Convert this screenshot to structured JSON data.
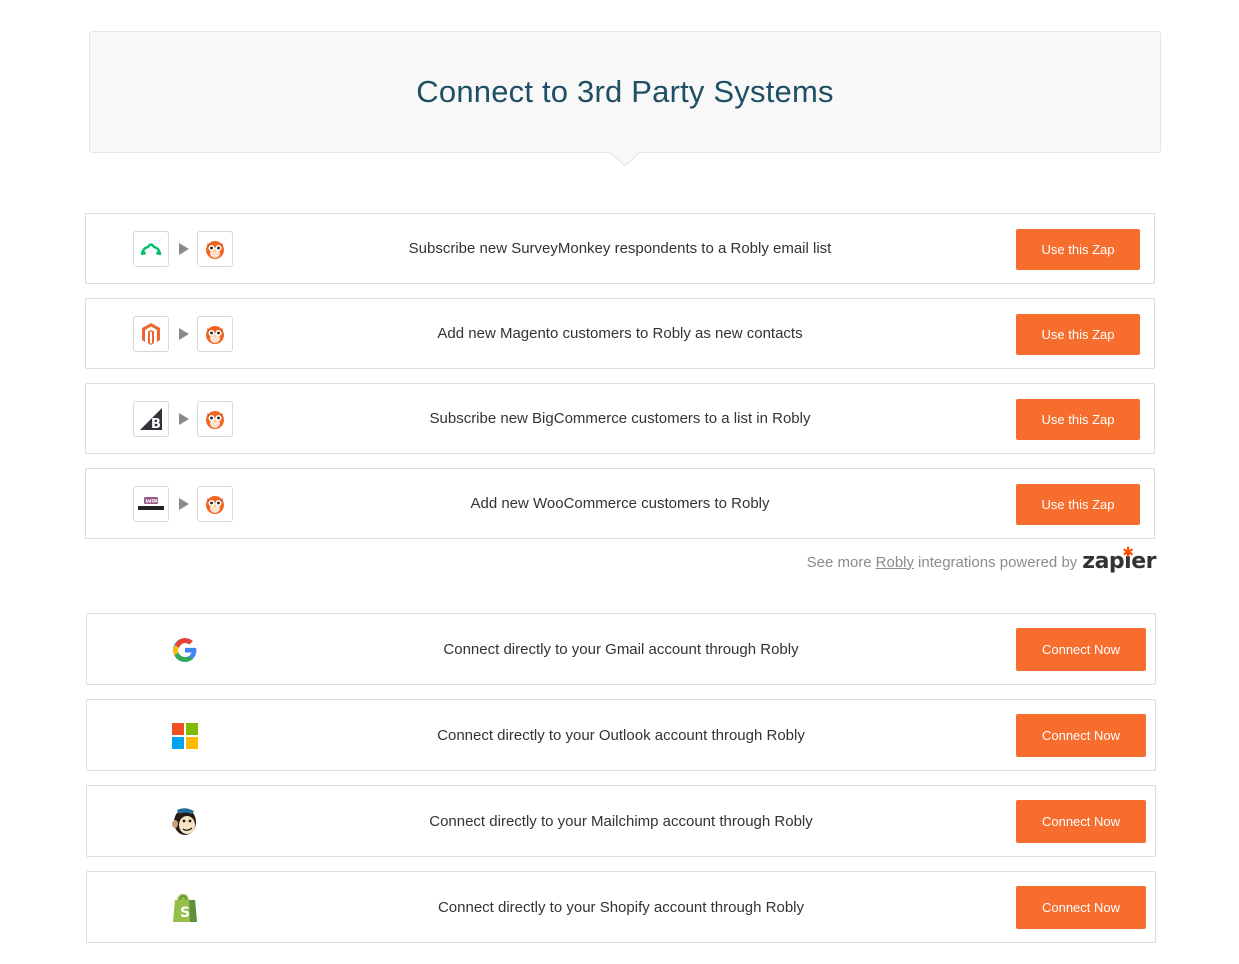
{
  "header": {
    "title": "Connect to 3rd Party Systems"
  },
  "zaps": [
    {
      "app_icon": "surveymonkey-icon",
      "text": "Subscribe new SurveyMonkey respondents to a Robly email list",
      "button": "Use this Zap"
    },
    {
      "app_icon": "magento-icon",
      "text": "Add new Magento customers to Robly as new contacts",
      "button": "Use this Zap"
    },
    {
      "app_icon": "bigcommerce-icon",
      "text": "Subscribe new BigCommerce customers to a list in Robly",
      "button": "Use this Zap"
    },
    {
      "app_icon": "woocommerce-icon",
      "text": "Add new WooCommerce customers to Robly",
      "button": "Use this Zap"
    }
  ],
  "target_icon": "robly-owl-icon",
  "see_more": {
    "prefix": "See more",
    "link": "Robly",
    "suffix": "integrations powered by",
    "brand": "zapier"
  },
  "connections": [
    {
      "icon": "google-icon",
      "text": "Connect directly to your Gmail account through Robly",
      "button": "Connect Now"
    },
    {
      "icon": "microsoft-icon",
      "text": "Connect directly to your Outlook account through Robly",
      "button": "Connect Now"
    },
    {
      "icon": "mailchimp-icon",
      "text": "Connect directly to your Mailchimp account through Robly",
      "button": "Connect Now"
    },
    {
      "icon": "shopify-icon",
      "text": "Connect directly to your Shopify account through Robly",
      "button": "Connect Now"
    }
  ],
  "colors": {
    "accent": "#f66d2e",
    "title": "#1f4f63",
    "border": "#dcdcdc",
    "header_bg": "#f8f8f8"
  }
}
